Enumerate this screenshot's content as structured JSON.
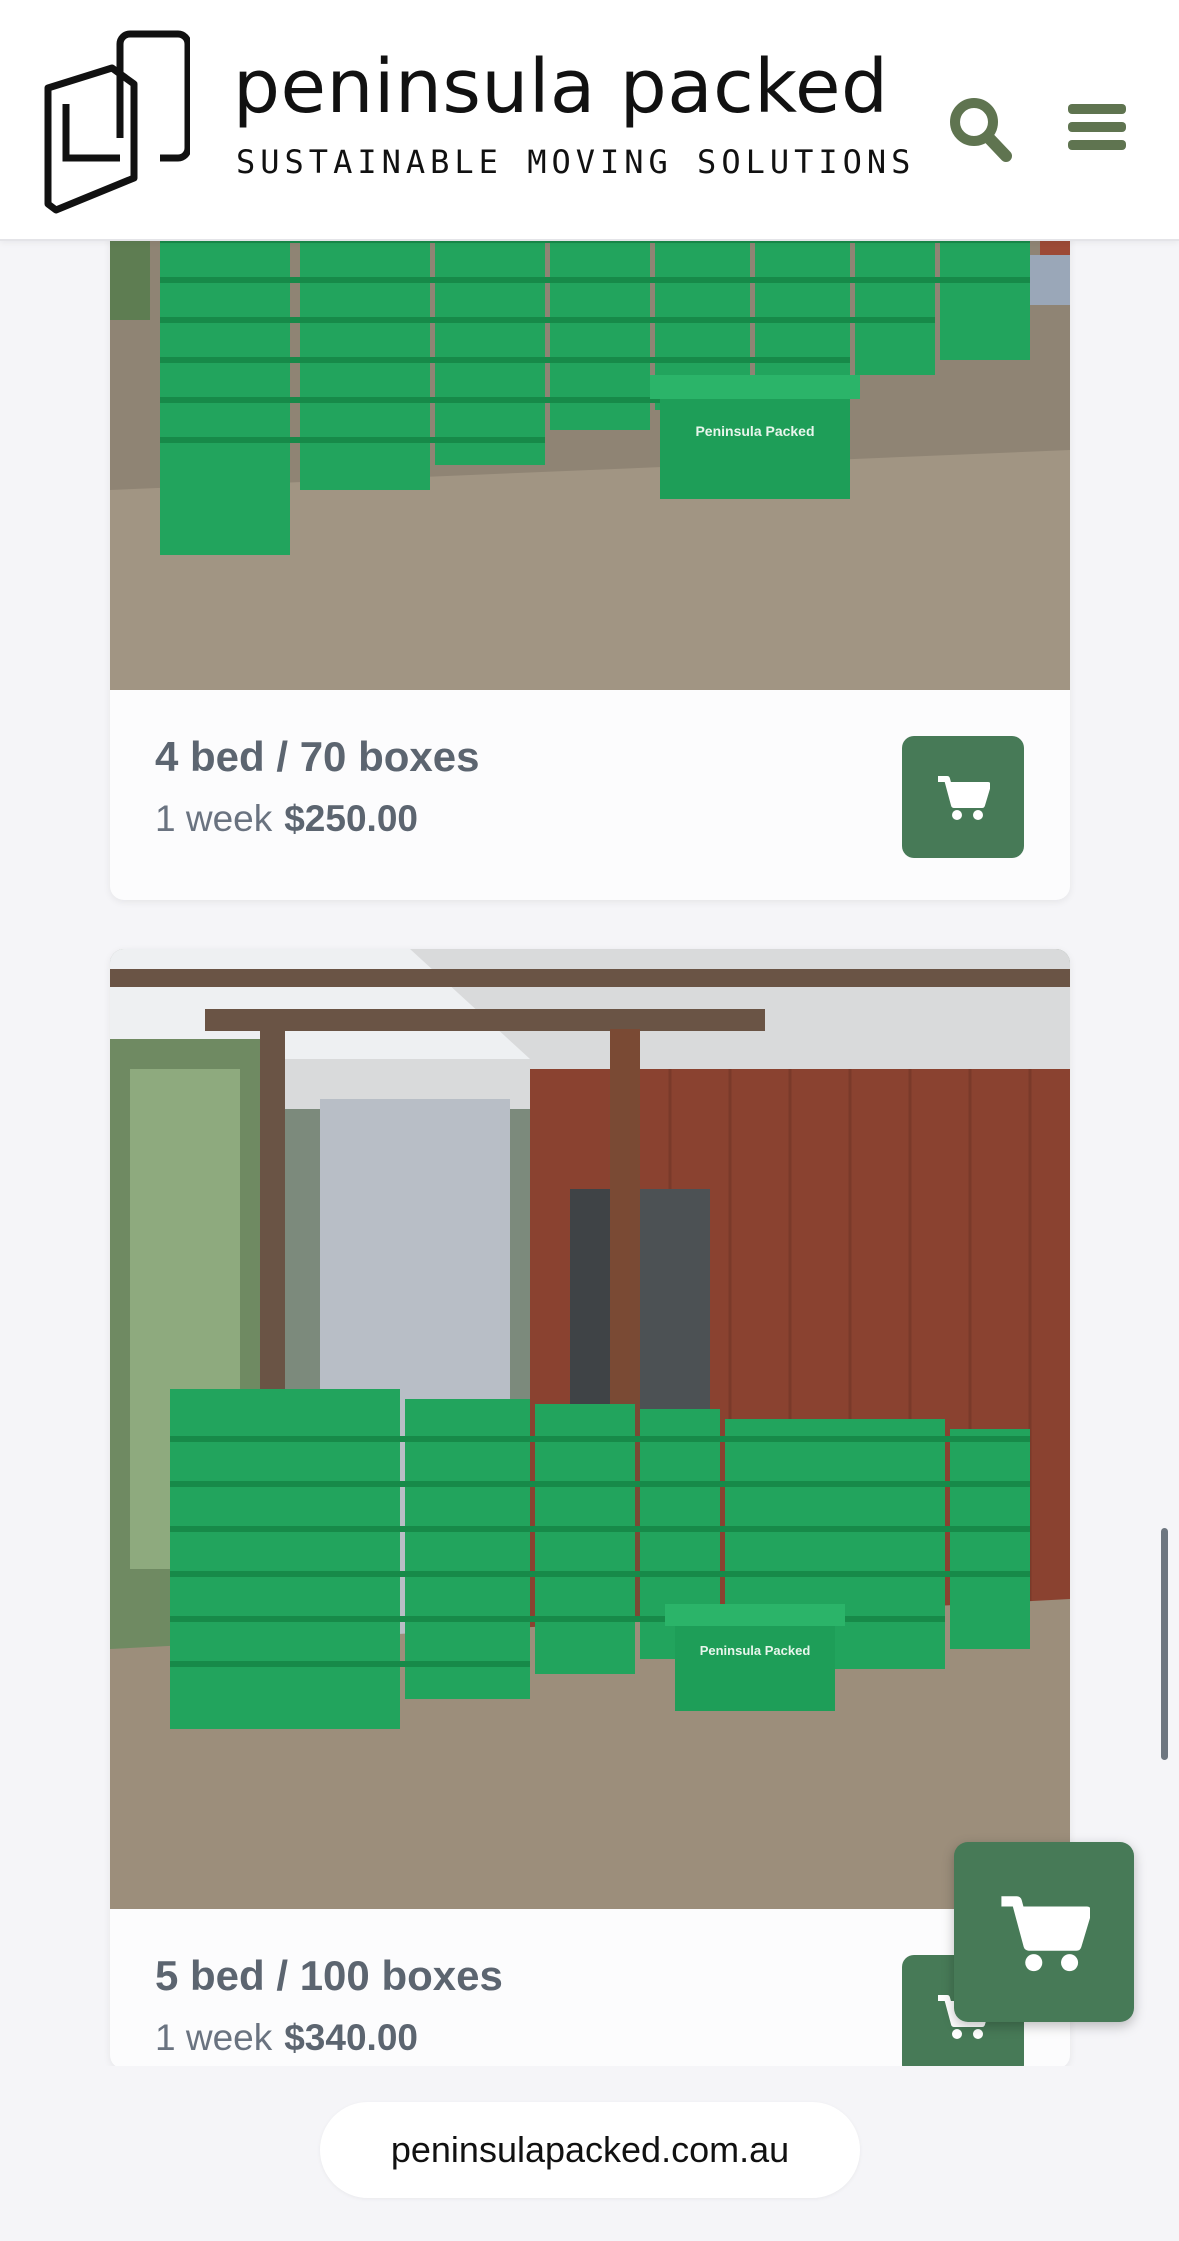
{
  "header": {
    "brand_name": "peninsula packed",
    "tagline": "SUSTAINABLE MOVING SOLUTIONS",
    "search_icon": "search-icon",
    "menu_icon": "hamburger-menu-icon"
  },
  "products": [
    {
      "title": "4 bed / 70 boxes",
      "duration": "1 week",
      "price": "$250.00",
      "image_box_label": "Peninsula Packed",
      "cart_icon": "cart-icon"
    },
    {
      "title": "5 bed / 100 boxes",
      "duration": "1 week",
      "price": "$340.00",
      "image_box_label": "Peninsula Packed",
      "cart_icon": "cart-icon"
    }
  ],
  "floating_cart": {
    "icon": "cart-icon"
  },
  "browser": {
    "url": "peninsulapacked.com.au"
  },
  "colors": {
    "accent_green": "#477a57",
    "crate_green": "#1e9e58",
    "text_gray": "#5c6570"
  }
}
